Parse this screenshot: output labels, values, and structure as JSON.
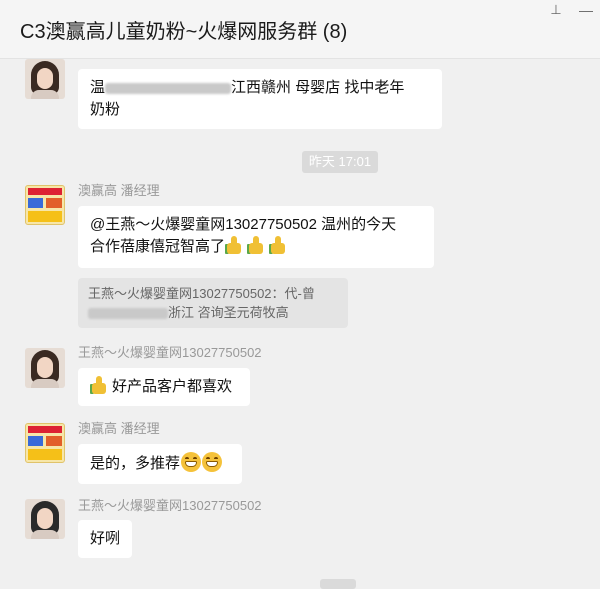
{
  "chat": {
    "title": "C3澳赢高儿童奶粉~火爆网服务群 (8)",
    "timestamp": "昨天 17:01"
  },
  "messages": [
    {
      "sender": "",
      "text_prefix": "温",
      "text_suffix": "江西赣州    母婴店    找中老年",
      "text_line2": "奶粉"
    },
    {
      "sender": "澳赢高 潘经理",
      "text_line1": "@王燕～火爆婴童网13027750502 温州的今天",
      "text_line2": "合作蓓康僖冠智高了",
      "quote_line1": "王燕～火爆婴童网13027750502：代-曾",
      "quote_line2": "浙江 咨询圣元荷牧高"
    },
    {
      "sender": "王燕～火爆婴童网13027750502",
      "text": "好产品客户都喜欢"
    },
    {
      "sender": "澳赢高 潘经理",
      "text": "是的，多推荐"
    },
    {
      "sender": "王燕～火爆婴童网13027750502",
      "text": "好咧"
    }
  ],
  "icons": {
    "pin": "pin-icon",
    "minimize": "minimize-icon",
    "emoji_thumb": "thumbs-up-icon",
    "emoji_grin": "grin-icon"
  }
}
